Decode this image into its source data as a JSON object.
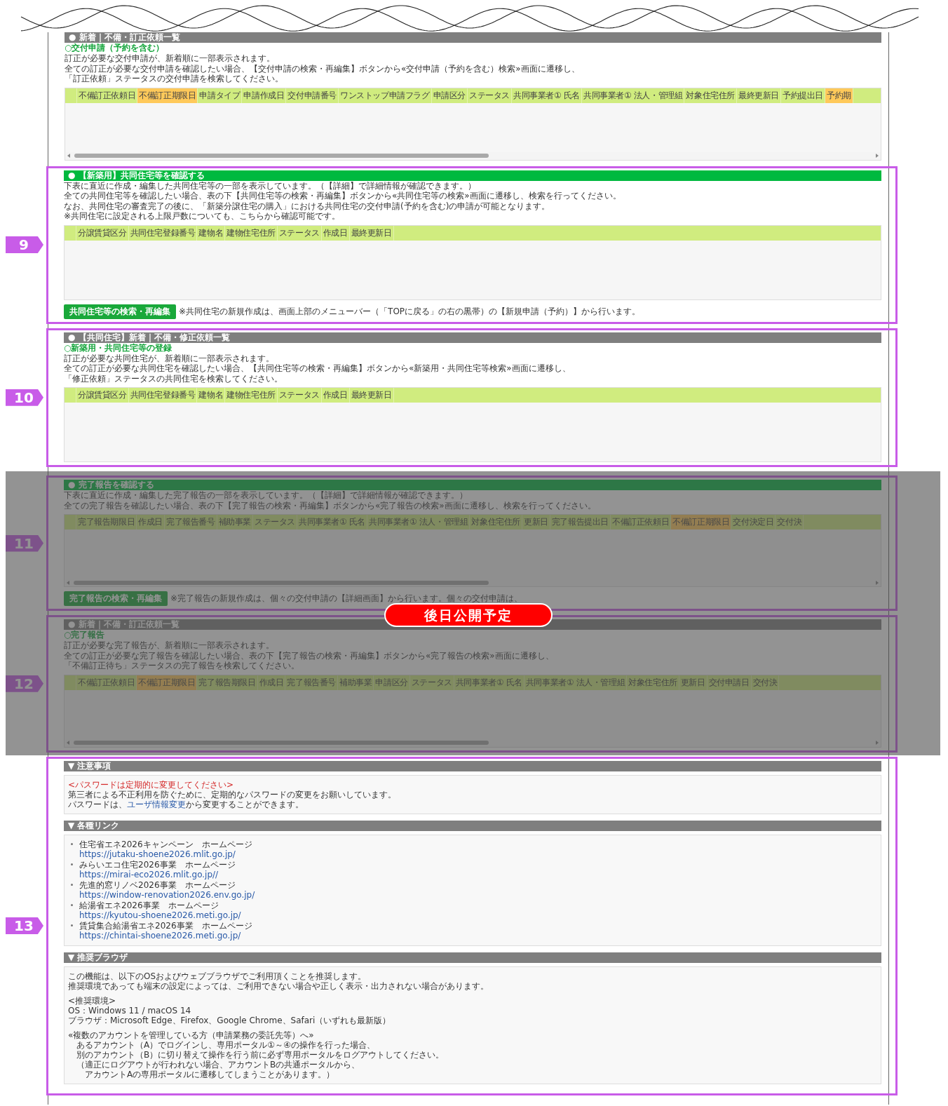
{
  "sections": [
    {
      "masked": false,
      "header": {
        "kind": "gray",
        "text": "● 新着｜不備・訂正依頼一覧"
      },
      "subtitle": "○交付申請（予約を含む）",
      "lines": [
        "訂正が必要な交付申請が、新着順に一部表示されます。",
        "全ての訂正が必要な交付申請を確認したい場合、【交付申請の検索・再編集】ボタンから«交付申請（予約を含む）検索»画面に遷移し、",
        "「訂正依頼」ステータスの交付申請を検索してください。"
      ],
      "table": {
        "scrollable": true,
        "columns": [
          {
            "label": "不備訂正依頼日",
            "highlighted": false
          },
          {
            "label": "不備訂正期限日",
            "highlighted": true
          },
          {
            "label": "申請タイプ",
            "highlighted": false
          },
          {
            "label": "申請作成日",
            "highlighted": false
          },
          {
            "label": "交付申請番号",
            "highlighted": false
          },
          {
            "label": "ワンストップ申請フラグ",
            "highlighted": false
          },
          {
            "label": "申請区分",
            "highlighted": false
          },
          {
            "label": "ステータス",
            "highlighted": false
          },
          {
            "label": "共同事業者① 氏名",
            "highlighted": false
          },
          {
            "label": "共同事業者① 法人・管理組",
            "highlighted": false
          },
          {
            "label": "対象住宅住所",
            "highlighted": false
          },
          {
            "label": "最終更新日",
            "highlighted": false
          },
          {
            "label": "予約提出日",
            "highlighted": false
          },
          {
            "label": "予約期",
            "highlighted": true
          }
        ]
      }
    },
    {
      "marker": "9",
      "masked": false,
      "header": {
        "kind": "green",
        "text": "● 【新築用】共同住宅等を確認する"
      },
      "lines": [
        "下表に直近に作成・編集した共同住宅等の一部を表示しています。（【詳細】で詳細情報が確認できます。）",
        "全ての共同住宅等を確認したい場合、表の下【共同住宅等の検索・再編集】ボタンから«共同住宅等の検索»画面に遷移し、検索を行ってください。",
        "なお、共同住宅の審査完了の後に、「新築分譲住宅の購入」における共同住宅の交付申請(予約を含む)の申請が可能となります。",
        "※共同住宅に設定される上限戸数についても、こちらから確認可能です。"
      ],
      "table": {
        "scrollable": false,
        "columns": [
          {
            "label": "分譲賃貸区分",
            "highlighted": false
          },
          {
            "label": "共同住宅登録番号",
            "highlighted": false
          },
          {
            "label": "建物名",
            "highlighted": false
          },
          {
            "label": "建物住宅住所",
            "highlighted": false
          },
          {
            "label": "ステータス",
            "highlighted": false
          },
          {
            "label": "作成日",
            "highlighted": false
          },
          {
            "label": "最終更新日",
            "highlighted": false
          }
        ]
      },
      "action": {
        "button": "共同住宅等の検索・再編集",
        "note": "※共同住宅の新規作成は、画面上部のメニューバー（「TOPに戻る」の右の黒帯）の【新規申請（予約）】から行います。"
      }
    },
    {
      "marker": "10",
      "masked": false,
      "header": {
        "kind": "gray",
        "text": "● 【共同住宅】新着｜不備・修正依頼一覧"
      },
      "subtitle": "○新築用・共同住宅等の登録",
      "lines": [
        "訂正が必要な共同住宅が、新着順に一部表示されます。",
        "全ての訂正が必要な共同住宅を確認したい場合、【共同住宅等の検索・再編集】ボタンから«新築用・共同住宅等検索»画面に遷移し、",
        "「修正依頼」ステータスの共同住宅を検索してください。"
      ],
      "table": {
        "scrollable": false,
        "columns": [
          {
            "label": "分譲賃貸区分",
            "highlighted": false
          },
          {
            "label": "共同住宅登録番号",
            "highlighted": false
          },
          {
            "label": "建物名",
            "highlighted": false
          },
          {
            "label": "建物住宅住所",
            "highlighted": false
          },
          {
            "label": "ステータス",
            "highlighted": false
          },
          {
            "label": "作成日",
            "highlighted": false
          },
          {
            "label": "最終更新日",
            "highlighted": false
          }
        ]
      }
    },
    {
      "marker": "11",
      "masked": true,
      "header": {
        "kind": "green",
        "text": "● 完了報告を確認する"
      },
      "lines": [
        "下表に直近に作成・編集した完了報告の一部を表示しています。（【詳細】で詳細情報が確認できます。）",
        "全ての完了報告を確認したい場合、表の下【完了報告の検索・再編集】ボタンから«完了報告の検索»画面に遷移し、検索を行ってください。"
      ],
      "table": {
        "scrollable": true,
        "columns": [
          {
            "label": "完了報告期限日",
            "highlighted": false
          },
          {
            "label": "作成日",
            "highlighted": false
          },
          {
            "label": "完了報告番号",
            "highlighted": false
          },
          {
            "label": "補助事業",
            "highlighted": false
          },
          {
            "label": "ステータス",
            "highlighted": false
          },
          {
            "label": "共同事業者① 氏名",
            "highlighted": false
          },
          {
            "label": "共同事業者① 法人・管理組",
            "highlighted": false
          },
          {
            "label": "対象住宅住所",
            "highlighted": false
          },
          {
            "label": "更新日",
            "highlighted": false
          },
          {
            "label": "完了報告提出日",
            "highlighted": false
          },
          {
            "label": "不備訂正依頼日",
            "highlighted": false
          },
          {
            "label": "不備訂正期限日",
            "highlighted": true
          },
          {
            "label": "交付決定日",
            "highlighted": false
          },
          {
            "label": "交付決",
            "highlighted": false
          }
        ]
      },
      "action": {
        "button": "完了報告の検索・再編集",
        "note": "※完了報告の新規作成は、個々の交付申請の【詳細画面】から行います。個々の交付申請は、"
      }
    },
    {
      "marker": "12",
      "masked": true,
      "header": {
        "kind": "gray",
        "text": "● 新着｜不備・訂正依頼一覧"
      },
      "subtitle": "○完了報告",
      "lines": [
        "訂正が必要な完了報告が、新着順に一部表示されます。",
        "全ての訂正が必要な完了報告を確認したい場合、表の下【完了報告の検索・再編集】ボタンから«完了報告の検索»画面に遷移し、",
        "「不備訂正待ち」ステータスの完了報告を検索してください。"
      ],
      "table": {
        "scrollable": true,
        "columns": [
          {
            "label": "不備訂正依頼日",
            "highlighted": false
          },
          {
            "label": "不備訂正期限日",
            "highlighted": true
          },
          {
            "label": "完了報告期限日",
            "highlighted": false
          },
          {
            "label": "作成日",
            "highlighted": false
          },
          {
            "label": "完了報告番号",
            "highlighted": false
          },
          {
            "label": "補助事業",
            "highlighted": false
          },
          {
            "label": "申請区分",
            "highlighted": false
          },
          {
            "label": "ステータス",
            "highlighted": false
          },
          {
            "label": "共同事業者① 氏名",
            "highlighted": false
          },
          {
            "label": "共同事業者① 法人・管理組",
            "highlighted": false
          },
          {
            "label": "対象住宅住所",
            "highlighted": false
          },
          {
            "label": "更新日",
            "highlighted": false
          },
          {
            "label": "交付申請日",
            "highlighted": false
          },
          {
            "label": "交付決",
            "highlighted": false
          }
        ]
      }
    }
  ],
  "pending_label": "後日公開予定",
  "info": {
    "marker": "13",
    "blocks": [
      {
        "kind": "notice",
        "title": "▼ 注意事項",
        "warning": "<パスワードは定期的に変更してください>",
        "lines": [
          "第三者による不正利用を防ぐために、定期的なパスワードの変更をお願いしています。"
        ],
        "link_line": {
          "before": "パスワードは、",
          "link": "ユーザ情報変更",
          "after": "から変更することができます。"
        }
      },
      {
        "kind": "links",
        "title": "▼ 各種リンク",
        "items": [
          {
            "title": "住宅省エネ2026キャンペーン　ホームページ",
            "url": "https://jutaku-shoene2026.mlit.go.jp/"
          },
          {
            "title": "みらいエコ住宅2026事業　ホームページ",
            "url": "https://mirai-eco2026.mlit.go.jp//"
          },
          {
            "title": "先進的窓リノベ2026事業　ホームページ",
            "url": "https://window-renovation2026.env.go.jp/"
          },
          {
            "title": "給湯省エネ2026事業　ホームページ",
            "url": "https://kyutou-shoene2026.meti.go.jp/"
          },
          {
            "title": "賃貸集合給湯省エネ2026事業　ホームページ",
            "url": "https://chintai-shoene2026.meti.go.jp/"
          }
        ]
      },
      {
        "kind": "text",
        "title": "▼ 推奨ブラウザ",
        "paragraphs": [
          [
            "この機能は、以下のOSおよびウェブブラウザでご利用頂くことを推奨します。",
            "推奨環境であっても端末の設定によっては、ご利用できない場合や正しく表示・出力されない場合があります。"
          ],
          [
            "<推奨環境>",
            "OS：Windows 11 / macOS 14",
            "ブラウザ：Microsoft Edge、Firefox、Google Chrome、Safari（いずれも最新版）"
          ],
          [
            "«複数のアカウントを管理している方（申請業務の委託先等）へ»",
            "　あるアカウント（A）でログインし、専用ポータル①～④の操作を行った場合、",
            "　別のアカウント（B）に切り替えて操作を行う前に必ず専用ポータルをログアウトしてください。",
            "　（適正にログアウトが行われない場合、アカウントBの共通ポータルから、",
            "　　アカウントAの専用ポータルに遷移してしまうことがあります。）"
          ]
        ]
      }
    ]
  }
}
